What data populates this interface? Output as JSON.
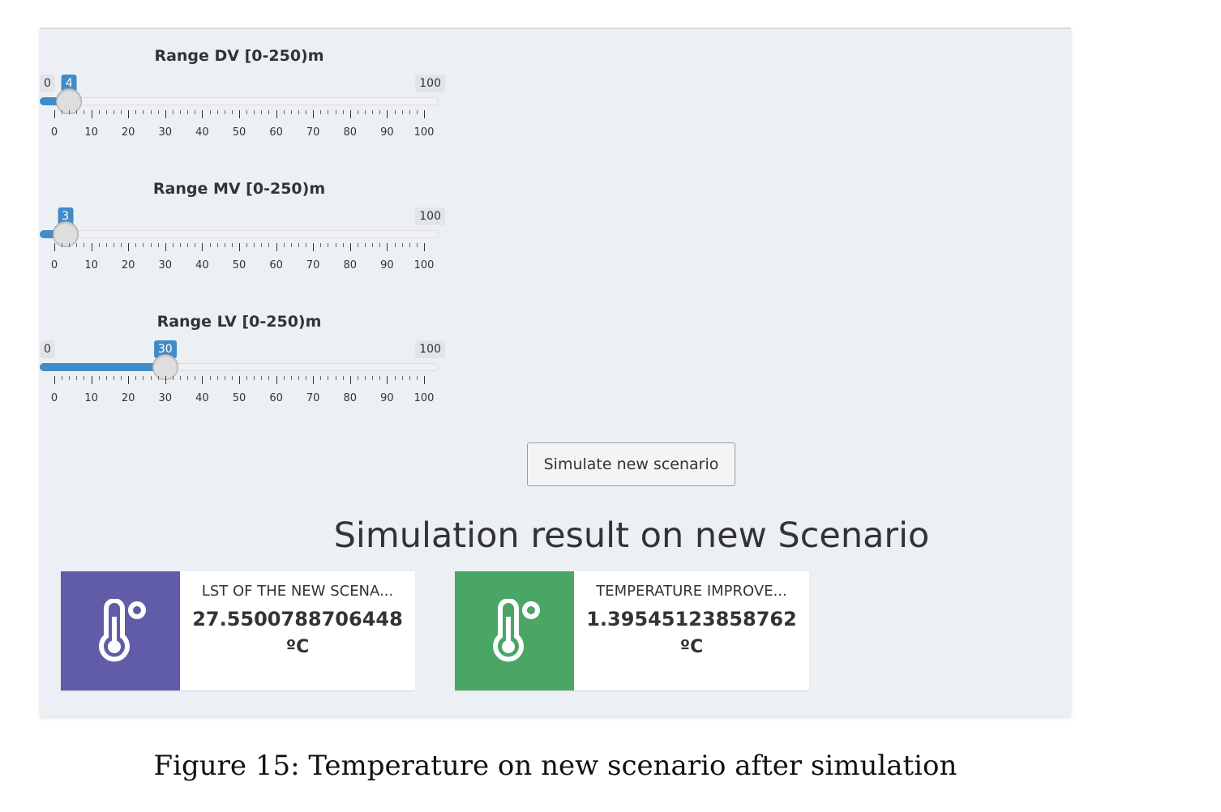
{
  "sliders": [
    {
      "label": "Range DV [0-250)m",
      "min_label": "0",
      "max_label": "100",
      "value": 4,
      "min": 0,
      "max": 100,
      "show_min": true
    },
    {
      "label": "Range MV [0-250)m",
      "min_label": "0",
      "max_label": "100",
      "value": 3,
      "min": 0,
      "max": 100,
      "show_min": false
    },
    {
      "label": "Range LV [0-250)m",
      "min_label": "0",
      "max_label": "100",
      "value": 30,
      "min": 0,
      "max": 100,
      "show_min": true
    }
  ],
  "tick_labels": [
    "0",
    "10",
    "20",
    "30",
    "40",
    "50",
    "60",
    "70",
    "80",
    "90",
    "100"
  ],
  "simulate_button": "Simulate new scenario",
  "result_title": "Simulation result on new Scenario",
  "infoboxes": [
    {
      "title": "LST OF THE NEW SCENA...",
      "value": "27.5500788706448",
      "unit": "ºC",
      "icon": "thermometer-icon",
      "color": "#605ca8"
    },
    {
      "title": "TEMPERATURE IMPROVE...",
      "value": "1.39545123858762",
      "unit": "ºC",
      "icon": "thermometer-icon",
      "color": "#4aa664"
    }
  ],
  "caption": "Figure 15: Temperature on new scenario after simulation"
}
